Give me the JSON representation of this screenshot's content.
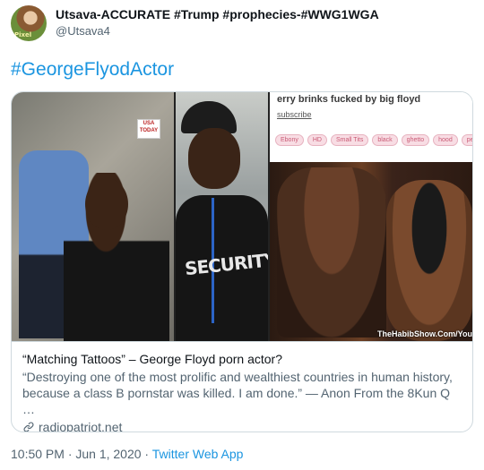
{
  "tweet": {
    "display_name": "Utsava-ACCURATE #Trump #prophecies-#WWG1WGA",
    "handle": "@Utsava4",
    "hashtag": "#GeorgeFlyodActor",
    "avatar_icon": "profile-avatar",
    "timestamp": "10:50 PM · Jun 1, 2020",
    "separator": " · ",
    "source_app": "Twitter Web App"
  },
  "card": {
    "title": "“Matching Tattoos” – George Floyd porn actor?",
    "description": "“Destroying one of the most prolific and wealthiest countries in human history, because a class B pornstar was killed. I am done.” — Anon From the 8Kun Q …",
    "domain": "radiopatriot.net",
    "link_icon": "link-icon",
    "image": {
      "panel_a_sign": "USA TODAY",
      "panel_b_shirt_text": "SECURITY",
      "panel_c_title": "erry brinks fucked by big floyd",
      "panel_c_subscribe": "subscribe",
      "panel_c_tags": [
        "Ebony",
        "HD",
        "Small Tits",
        "black",
        "ghetto",
        "hood",
        "pe"
      ],
      "panel_c_watermark": "TheHabibShow.Com/You"
    }
  },
  "colors": {
    "accent": "#1b95e0",
    "text": "#0f1419",
    "secondary": "#536471",
    "border": "#cfd9de"
  }
}
